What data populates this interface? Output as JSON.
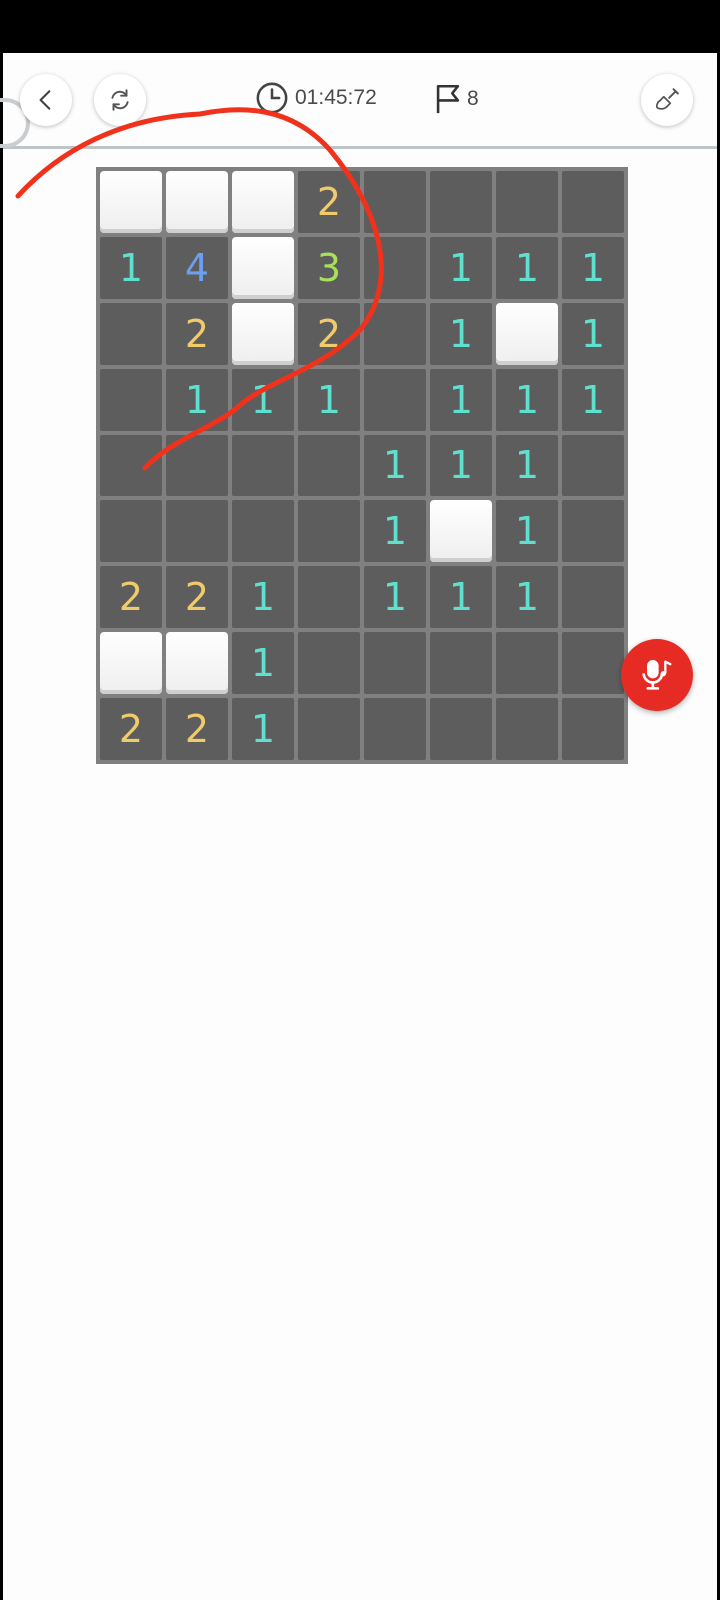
{
  "header": {
    "timer": "01:45:72",
    "flag_count": "8",
    "icons": [
      "back-icon",
      "restart-icon",
      "clock-icon",
      "flag-icon",
      "shovel-icon"
    ]
  },
  "board": {
    "rows": 9,
    "cols": 8,
    "legend": "H = unrevealed tile, '' = revealed empty, number = adjacent mine count",
    "cells": [
      [
        "H",
        "H",
        "H",
        "2",
        "",
        "",
        "",
        ""
      ],
      [
        "1",
        "4",
        "H",
        "3",
        "",
        "1",
        "1",
        "1"
      ],
      [
        "",
        "2",
        "H",
        "2",
        "",
        "1",
        "H",
        "1"
      ],
      [
        "",
        "1",
        "1",
        "1",
        "",
        "1",
        "1",
        "1"
      ],
      [
        "",
        "",
        "",
        "",
        "1",
        "1",
        "1",
        ""
      ],
      [
        "",
        "",
        "",
        "",
        "1",
        "H",
        "1",
        ""
      ],
      [
        "2",
        "2",
        "1",
        "",
        "1",
        "1",
        "1",
        ""
      ],
      [
        "H",
        "H",
        "1",
        "",
        "",
        "",
        "",
        ""
      ],
      [
        "2",
        "2",
        "1",
        "",
        "",
        "",
        "",
        ""
      ]
    ]
  },
  "colors": {
    "background": "#fcfdfc",
    "board_bg": "#808080",
    "revealed_cell": "#5d5d5d",
    "hidden_cell": "#ffffff",
    "number_1": "#5fe0cf",
    "number_2": "#f0cb6b",
    "number_3": "#a7e05a",
    "number_4": "#6b9ff0",
    "mic_button": "#e52b24",
    "annotation_stroke": "#f0321c"
  },
  "overlay": {
    "mic_icon": "mic-music-icon"
  }
}
